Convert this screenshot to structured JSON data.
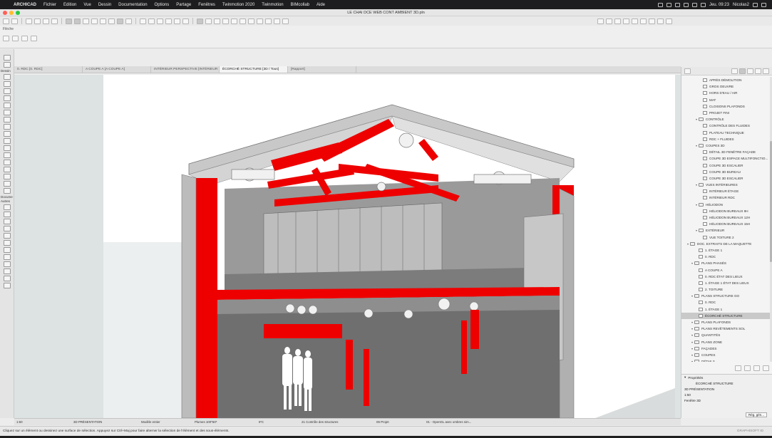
{
  "menubar": {
    "app": "ARCHICAD",
    "items": [
      "Fichier",
      "Edition",
      "Vue",
      "Dessin",
      "Documentation",
      "Options",
      "Partage",
      "Fenêtres",
      "Twinmotion 2020",
      "Twinmotion",
      "BIMcollab",
      "Aide"
    ],
    "clock": "Jeu. 09:23",
    "user": "Nicolas2"
  },
  "window": {
    "title": "LE CHAI DCE WEB CONT AMBIENT 3D.pln"
  },
  "infobox": {
    "label": "Flèche"
  },
  "toolbox": {
    "sections": [
      "Dessin",
      "Docume",
      "Autres"
    ]
  },
  "tabs": [
    {
      "label": "0. RDC [0. RDC]",
      "active": false
    },
    {
      "label": "A COUPE A [A COUPE A]",
      "active": false
    },
    {
      "label": "INTÉRIEUR PERSPECTIVE [INTÉRIEUR P...",
      "active": false
    },
    {
      "label": "ÉCORCHÉ STRUCTURE [3D / Tous]",
      "active": true
    },
    {
      "label": "[Rapport]",
      "active": false
    }
  ],
  "navigator": {
    "tree": [
      {
        "label": "APRÈS DÉMOLITION",
        "level": 4,
        "kind": "view"
      },
      {
        "label": "GROS OEUVRE",
        "level": 4,
        "kind": "view"
      },
      {
        "label": "HORS D'EAU / AIR",
        "level": 4,
        "kind": "view"
      },
      {
        "label": "MAT",
        "level": 4,
        "kind": "view"
      },
      {
        "label": "CLOISONS PLAFONDS",
        "level": 4,
        "kind": "view"
      },
      {
        "label": "PROJET FINI",
        "level": 4,
        "kind": "view"
      },
      {
        "label": "CONTRÔLE",
        "level": 3,
        "kind": "folder"
      },
      {
        "label": "CONTRÔLE DES FLUIDES",
        "level": 4,
        "kind": "view"
      },
      {
        "label": "PLATEAU TECHNIQUE",
        "level": 4,
        "kind": "view"
      },
      {
        "label": "RDC + FLUIDES",
        "level": 4,
        "kind": "view"
      },
      {
        "label": "COUPES 3D",
        "level": 3,
        "kind": "folder"
      },
      {
        "label": "DÉTAIL 3D FENÊTRE FAÇADE",
        "level": 4,
        "kind": "view"
      },
      {
        "label": "COUPE 3D ESPACE MULTIFONCTIO...",
        "level": 4,
        "kind": "view"
      },
      {
        "label": "COUPE 3D ESCALIER",
        "level": 4,
        "kind": "view"
      },
      {
        "label": "COUPE 3D BUREAU",
        "level": 4,
        "kind": "view"
      },
      {
        "label": "COUPE 3D ESCALIER",
        "level": 4,
        "kind": "view"
      },
      {
        "label": "VUES INTÉRIEURES",
        "level": 3,
        "kind": "folder"
      },
      {
        "label": "INTÉRIEUR ÉTAGE",
        "level": 4,
        "kind": "view"
      },
      {
        "label": "INTÉRIEUR RDC",
        "level": 4,
        "kind": "view"
      },
      {
        "label": "HÉLIODON",
        "level": 3,
        "kind": "folder"
      },
      {
        "label": "HÉLIODON BUREAUX 9H",
        "level": 4,
        "kind": "view"
      },
      {
        "label": "HÉLIODON BUREAUX 12H",
        "level": 4,
        "kind": "view"
      },
      {
        "label": "HÉLIODON BUREAUX 15H",
        "level": 4,
        "kind": "view"
      },
      {
        "label": "EXTÉRIEUR",
        "level": 3,
        "kind": "folder"
      },
      {
        "label": "VUE TOITURE 2",
        "level": 4,
        "kind": "view"
      },
      {
        "label": "DOC. EXTRAITS DE LA MAQUETTE",
        "level": 1,
        "kind": "folder"
      },
      {
        "label": "1. ÉTAGE 1",
        "level": 3,
        "kind": "view"
      },
      {
        "label": "0. RDC",
        "level": 3,
        "kind": "view"
      },
      {
        "label": "PLANS PHASÉS",
        "level": 2,
        "kind": "folder"
      },
      {
        "label": "A COUPE A",
        "level": 3,
        "kind": "view"
      },
      {
        "label": "0. RDC ÉTAT DES LIEUX",
        "level": 3,
        "kind": "view"
      },
      {
        "label": "1. ÉTAGE 1 ÉTAT DES LIEUX",
        "level": 3,
        "kind": "view"
      },
      {
        "label": "2. TOITURE",
        "level": 3,
        "kind": "view"
      },
      {
        "label": "PLANS STRUCTURE GO",
        "level": 2,
        "kind": "folder"
      },
      {
        "label": "0. RDC",
        "level": 3,
        "kind": "view"
      },
      {
        "label": "1. ÉTAGE 1",
        "level": 3,
        "kind": "view"
      },
      {
        "label": "ÉCORCHÉ STRUCTURE",
        "level": 3,
        "kind": "view",
        "selected": true
      },
      {
        "label": "PLANS PLAFONDS",
        "level": 2,
        "kind": "folder"
      },
      {
        "label": "PLANS REVÊTEMENTS SOL",
        "level": 2,
        "kind": "folder"
      },
      {
        "label": "QUANTITÉS",
        "level": 2,
        "kind": "folder"
      },
      {
        "label": "PLANS ZONE",
        "level": 2,
        "kind": "folder"
      },
      {
        "label": "FAÇADES",
        "level": 2,
        "kind": "folder"
      },
      {
        "label": "COUPES",
        "level": 2,
        "kind": "folder"
      },
      {
        "label": "DÉTAILS",
        "level": 2,
        "kind": "folder"
      }
    ],
    "properties": {
      "header": "Propriétés",
      "name": "ÉCORCHÉ STRUCTURE",
      "view": "3D PRÉSENTATION",
      "scale": "1:50",
      "window": "Fenêtre 3D",
      "edit_label": "Rég. gén..."
    }
  },
  "statusbar": {
    "cells": [
      "1:60",
      "3D PRÉSENTATION",
      "Modèle entier",
      "Plumes 100*50*",
      "IFC",
      "21 Contrôle des structures",
      "06 Projet",
      "01 - OpenGL avec ombres sim..."
    ],
    "hint": "Cliquez sur un élément ou dessinez une surface de sélection. Appuyez sur Ctrl+Maj pour faire alterner la sélection de l'élément et des sous-éléments.",
    "recorder": "GRAPHISOFT ID"
  },
  "colors": {
    "structure_red": "#ee0000",
    "concrete_gray": "#8e8e8e",
    "floor_gray": "#6f6f6f"
  }
}
